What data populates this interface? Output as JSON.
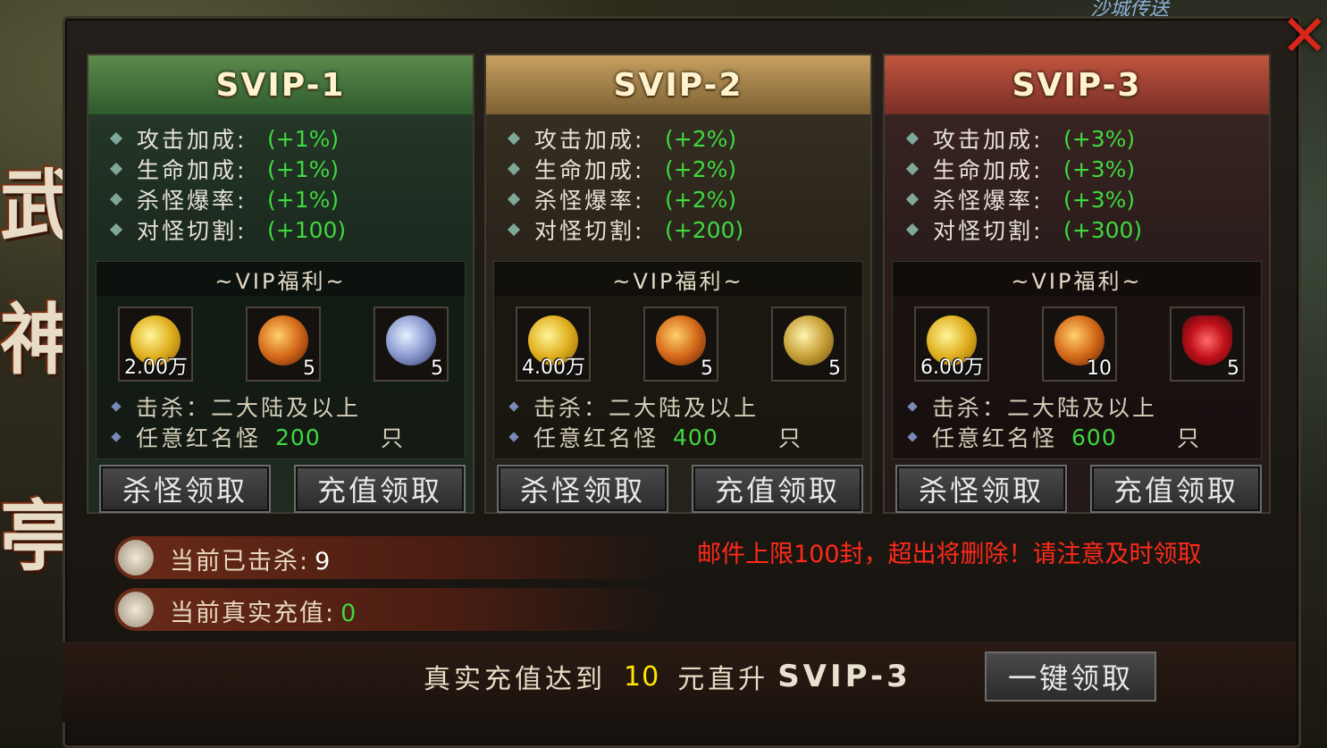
{
  "tiers": [
    {
      "title": "SVIP-1",
      "stats": [
        {
          "label": "攻击加成:",
          "value": "(+1%)"
        },
        {
          "label": "生命加成:",
          "value": "(+1%)"
        },
        {
          "label": "杀怪爆率:",
          "value": "(+1%)"
        },
        {
          "label": "对怪切割:",
          "value": "(+100)"
        }
      ],
      "benefit_title": "~VIP福利~",
      "items": [
        {
          "icon": "gold-coins-icon",
          "count": "2.00万"
        },
        {
          "icon": "fire-orb-icon",
          "count": "5"
        },
        {
          "icon": "silver-medal-icon",
          "count": "5"
        }
      ],
      "req1": "击杀：二大陆及以上",
      "req2_label": "任意红名怪",
      "req2_num": "200",
      "req2_unit": "只",
      "btn_kill": "杀怪领取",
      "btn_charge": "充值领取"
    },
    {
      "title": "SVIP-2",
      "stats": [
        {
          "label": "攻击加成:",
          "value": "(+2%)"
        },
        {
          "label": "生命加成:",
          "value": "(+2%)"
        },
        {
          "label": "杀怪爆率:",
          "value": "(+2%)"
        },
        {
          "label": "对怪切割:",
          "value": "(+200)"
        }
      ],
      "benefit_title": "~VIP福利~",
      "items": [
        {
          "icon": "gold-coins-icon",
          "count": "4.00万"
        },
        {
          "icon": "fire-orb-icon",
          "count": "5"
        },
        {
          "icon": "gold-medal-icon",
          "count": "5"
        }
      ],
      "req1": "击杀：二大陆及以上",
      "req2_label": "任意红名怪",
      "req2_num": "400",
      "req2_unit": "只",
      "btn_kill": "杀怪领取",
      "btn_charge": "充值领取"
    },
    {
      "title": "SVIP-3",
      "stats": [
        {
          "label": "攻击加成:",
          "value": "(+3%)"
        },
        {
          "label": "生命加成:",
          "value": "(+3%)"
        },
        {
          "label": "杀怪爆率:",
          "value": "(+3%)"
        },
        {
          "label": "对怪切割:",
          "value": "(+300)"
        }
      ],
      "benefit_title": "~VIP福利~",
      "items": [
        {
          "icon": "gold-coins-icon",
          "count": "6.00万"
        },
        {
          "icon": "fire-orb-icon",
          "count": "10"
        },
        {
          "icon": "red-gem-icon",
          "count": "5"
        }
      ],
      "req1": "击杀：二大陆及以上",
      "req2_label": "任意红名怪",
      "req2_num": "600",
      "req2_unit": "只",
      "btn_kill": "杀怪领取",
      "btn_charge": "充值领取"
    }
  ],
  "kills": {
    "label": "当前已击杀:",
    "value": "9"
  },
  "recharge": {
    "label": "当前真实充值:",
    "value": "0"
  },
  "notice": "邮件上限100封，超出将删除！请注意及时领取",
  "bottom": {
    "prefix": "真实充值达到",
    "amount": "10",
    "mid": "元直升",
    "level": "SVIP-3",
    "button": "一键领取"
  },
  "side_glyphs": [
    "武",
    "神",
    "亭"
  ],
  "colors": {
    "green": "#3fd83f",
    "red_notice": "#ff2a1a",
    "yellow": "#ffe400"
  }
}
